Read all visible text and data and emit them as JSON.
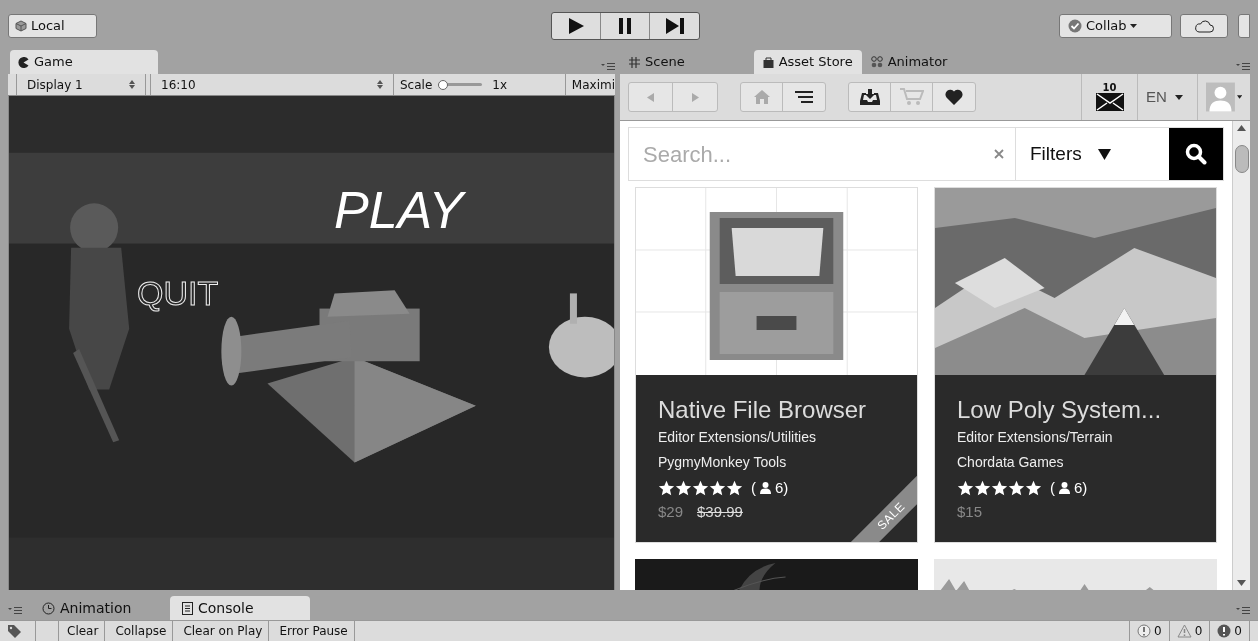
{
  "toolbar": {
    "account": "Local",
    "collab": "Collab"
  },
  "game_panel": {
    "tab": "Game",
    "display": "Display 1",
    "aspect": "16:10",
    "scale_label": "Scale",
    "scale": {
      "level": 0
    },
    "scale_value": "1x",
    "maximize": "Maximi"
  },
  "game_view": {
    "play_text": "PLAY",
    "quit_text": "QUIT"
  },
  "right_tabs": [
    {
      "label": "Scene",
      "kind": "grid",
      "selected": false
    },
    {
      "label": "Asset Store",
      "kind": "bag",
      "selected": true
    },
    {
      "label": "Animator",
      "kind": "nodes",
      "selected": false
    }
  ],
  "store_toolbar": {
    "mail_count": "10",
    "language": "EN"
  },
  "search": {
    "placeholder": "Search...",
    "filters": "Filters"
  },
  "cards": [
    {
      "title": "Native File Browser",
      "category": "Editor Extensions/Utilities",
      "publisher": "PygmyMonkey Tools",
      "stars": 5,
      "rating_open": "(",
      "rating_count": "6)",
      "price": "$29",
      "old_price": "$39.99",
      "badge": "SALE",
      "kind": "cabinet"
    },
    {
      "title": "Low Poly System...",
      "category": "Editor Extensions/Terrain",
      "publisher": "Chordata Games",
      "stars": 5,
      "rating_open": "(",
      "rating_count": "6)",
      "price": "$15",
      "kind": "mountain"
    }
  ],
  "bottom_tabs": [
    {
      "label": "Animation",
      "kind": "clock",
      "selected": false
    },
    {
      "label": "Console",
      "kind": "page",
      "selected": true
    }
  ],
  "console_buttons": [
    "Clear",
    "Collapse",
    "Clear on Play",
    "Error Pause"
  ],
  "counters": [
    {
      "kind": "info",
      "count": "0"
    },
    {
      "kind": "warning",
      "count": "0"
    },
    {
      "kind": "error",
      "count": "0"
    }
  ]
}
